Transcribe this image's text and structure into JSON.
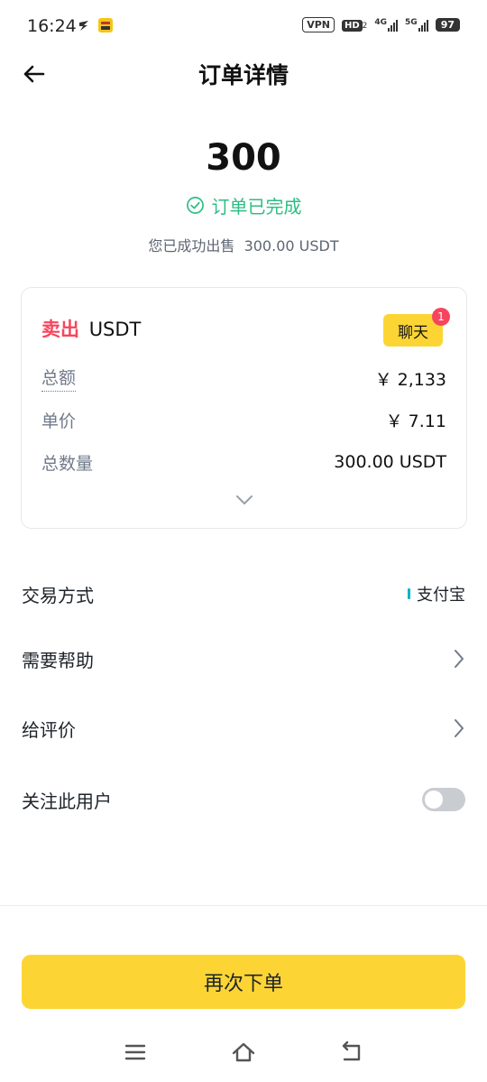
{
  "status_bar": {
    "time": "16:24",
    "vpn": "VPN",
    "hd": "HD",
    "hd_sub": "2",
    "net1": "4G",
    "net2": "5G",
    "battery": "97"
  },
  "header": {
    "title": "订单详情",
    "back_icon": "back-arrow-icon"
  },
  "summary": {
    "amount": "300",
    "status": "订单已完成",
    "status_color": "#2ebd85",
    "description": "您已成功出售  300.00 USDT"
  },
  "order_card": {
    "side": "卖出",
    "asset": "USDT",
    "chat_label": "聊天",
    "chat_badge": "1",
    "rows": [
      {
        "label": "总额",
        "value": "￥ 2,133"
      },
      {
        "label": "单价",
        "value": "￥ 7.11"
      },
      {
        "label": "总数量",
        "value": "300.00 USDT"
      }
    ]
  },
  "details": {
    "payment_label": "交易方式",
    "payment_value": "支付宝",
    "help_label": "需要帮助",
    "review_label": "给评价",
    "follow_label": "关注此用户",
    "follow_enabled": false
  },
  "actions": {
    "reorder": "再次下单"
  },
  "colors": {
    "accent": "#fcd535",
    "sell": "#f6465d",
    "success": "#2ebd85"
  }
}
